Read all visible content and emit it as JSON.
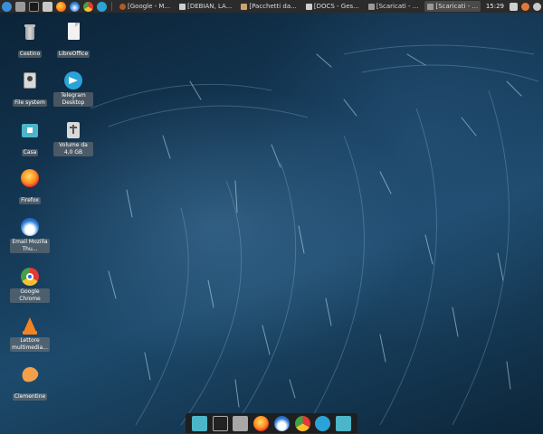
{
  "colors": {
    "panel_bg": "#2b2b2b",
    "wallpaper_dark": "#0b2236",
    "wallpaper_mid": "#1d4a6c",
    "folder_teal": "#4bb6c9",
    "telegram_blue": "#2aa3d9",
    "firefox_orange": "#ff7a1a",
    "vlc_orange": "#f58220"
  },
  "panel": {
    "launchers": [
      {
        "name": "whisker-menu-icon"
      },
      {
        "name": "file-manager-icon"
      },
      {
        "name": "terminal-icon"
      },
      {
        "name": "mail-icon"
      },
      {
        "name": "firefox-icon"
      },
      {
        "name": "thunderbird-icon"
      },
      {
        "name": "chrome-icon"
      },
      {
        "name": "telegram-icon"
      }
    ],
    "tasks": [
      {
        "label": "[Google - M...",
        "icon": "browser-icon",
        "active": false
      },
      {
        "label": "[DEBIAN, LA...",
        "icon": "document-icon",
        "active": false
      },
      {
        "label": "[Pacchetti da...",
        "icon": "document-icon",
        "active": false
      },
      {
        "label": "[DOCS - Ges...",
        "icon": "document-icon",
        "active": false
      },
      {
        "label": "[Scaricati - ...",
        "icon": "folder-icon",
        "active": false
      },
      {
        "label": "[Scaricati - ...",
        "icon": "folder-icon",
        "active": false
      }
    ],
    "clock": "15:29"
  },
  "desktop": {
    "col1": [
      {
        "label": "Cestino",
        "icon": "trash-icon"
      },
      {
        "label": "File system",
        "icon": "hard-drive-icon"
      },
      {
        "label": "Casa",
        "icon": "home-folder-icon"
      },
      {
        "label": "Firefox",
        "icon": "firefox-icon"
      },
      {
        "label": "Email Mozilla Thu...",
        "icon": "thunderbird-icon"
      },
      {
        "label": "Google Chrome",
        "icon": "chrome-icon"
      },
      {
        "label": "Lettore multimedia...",
        "icon": "vlc-icon"
      },
      {
        "label": "Clementine",
        "icon": "clementine-icon"
      }
    ],
    "col2": [
      {
        "label": "LibreOffice",
        "icon": "document-icon"
      },
      {
        "label": "Telegram Desktop",
        "icon": "telegram-icon"
      },
      {
        "label": "Volume da 4,0 GB",
        "icon": "usb-drive-icon"
      }
    ]
  },
  "dock": {
    "items": [
      {
        "name": "files-icon"
      },
      {
        "name": "terminal-icon"
      },
      {
        "name": "file-manager-icon"
      },
      {
        "name": "firefox-icon"
      },
      {
        "name": "thunderbird-icon"
      },
      {
        "name": "chrome-icon"
      },
      {
        "name": "telegram-icon"
      },
      {
        "name": "folder-icon"
      }
    ]
  }
}
